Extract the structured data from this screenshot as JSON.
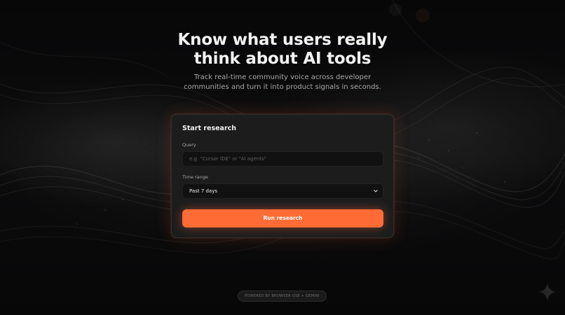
{
  "hero": {
    "title_line1": "Know what users really",
    "title_line2": "think about AI tools",
    "subtitle_line1": "Track real-time community voice across developer",
    "subtitle_line2": "communities and turn it into product signals in seconds."
  },
  "form": {
    "title": "Start research",
    "query_label": "Query",
    "query_value": "",
    "query_placeholder": "e.g. \"Cursor IDE\" or \"AI agents\"",
    "time_label": "Time range",
    "time_selected": "Past 7 days",
    "submit_label": "Run research"
  },
  "footer": {
    "powered_by": "POWERED BY BROWSER USE + GEMINI"
  },
  "icons": {
    "select_caret": "chevron-down-icon",
    "corner": "sparkle-icon"
  },
  "colors": {
    "accent": "#ff6b35",
    "background": "#0b0b0c",
    "card": "#1c1c1d"
  }
}
